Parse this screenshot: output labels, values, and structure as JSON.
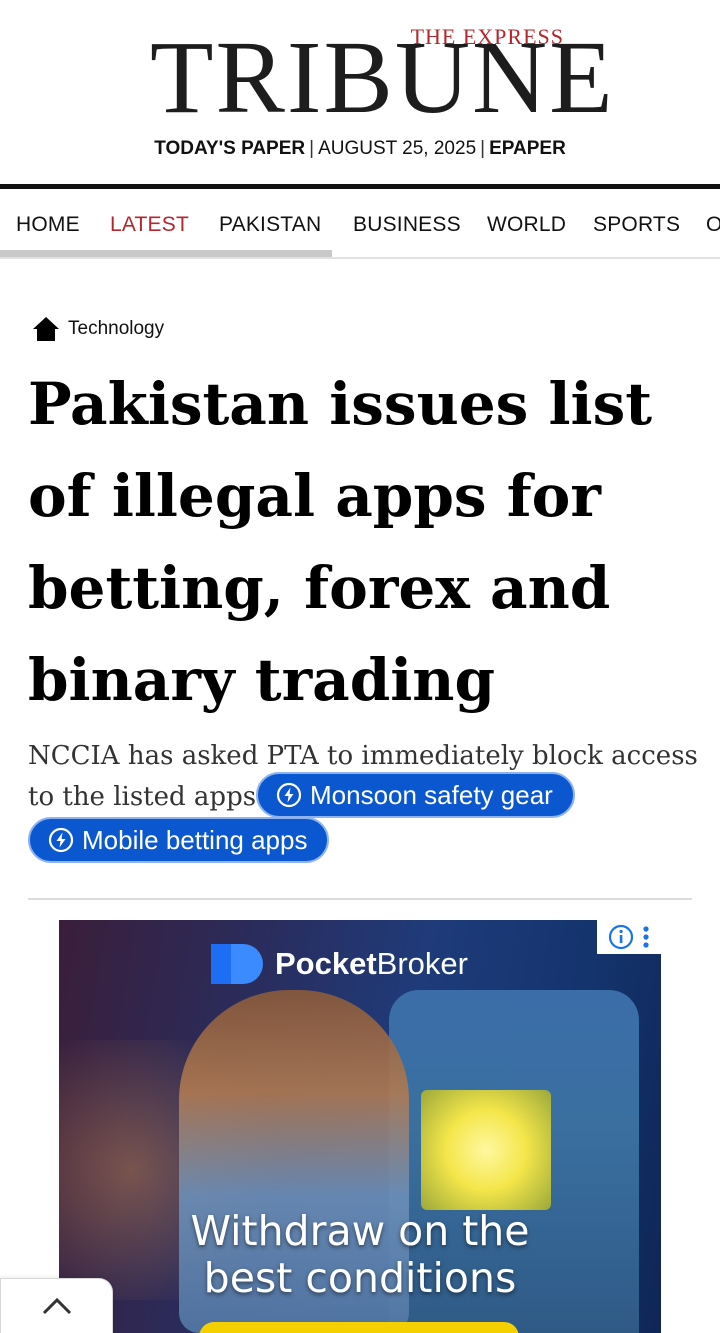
{
  "masthead": {
    "logo_small": "THE EXPRESS",
    "logo_big": "TRIBUNE",
    "todays_paper": "TODAY'S PAPER",
    "date": "AUGUST 25, 2025",
    "epaper": "EPAPER",
    "separator": "|"
  },
  "nav": {
    "items": [
      {
        "label": "HOME"
      },
      {
        "label": "LATEST"
      },
      {
        "label": "PAKISTAN"
      },
      {
        "label": "BUSINESS"
      },
      {
        "label": "WORLD"
      },
      {
        "label": "SPORTS"
      },
      {
        "label": "O"
      }
    ],
    "active": "LATEST"
  },
  "article": {
    "category": "Technology",
    "headline": "Pakistan issues list of illegal apps for betting, forex and binary trading",
    "dek": "NCCIA has asked PTA to immediately block access to the listed apps",
    "chips": [
      {
        "label": "Monsoon safety gear"
      },
      {
        "label": "Mobile betting apps"
      }
    ]
  },
  "ad": {
    "brand_bold": "Pocket",
    "brand_regular": "Broker",
    "tagline_line1": "Withdraw on the",
    "tagline_line2": "best conditions"
  },
  "colors": {
    "accent_red": "#b3262b",
    "chip_blue": "#0b57d0"
  },
  "icons": [
    "home-icon",
    "bolt-icon",
    "info-icon",
    "more-vert-icon",
    "chevron-up-icon"
  ]
}
